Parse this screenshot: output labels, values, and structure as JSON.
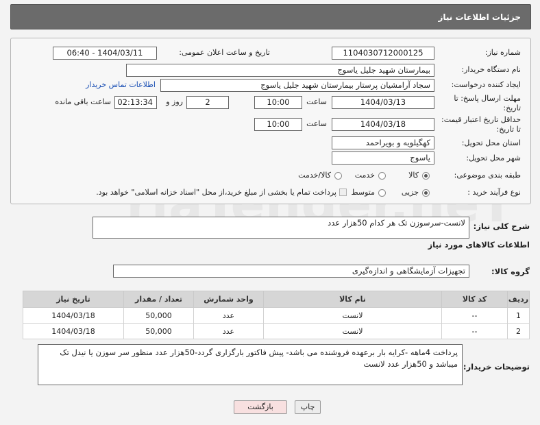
{
  "header": {
    "title": "جزئیات اطلاعات نیاز"
  },
  "form": {
    "need_number_label": "شماره نیاز:",
    "need_number": "1104030712000125",
    "announce_label": "تاریخ و ساعت اعلان عمومی:",
    "announce_value": "1404/03/11 - 06:40",
    "buyer_org_label": "نام دستگاه خریدار:",
    "buyer_org": "بیمارستان شهید جلیل یاسوج",
    "creator_label": "ایجاد کننده درخواست:",
    "creator": "سجاد آرامشیان پرستار بیمارستان شهید جلیل یاسوج",
    "contact_link": "اطلاعات تماس خریدار",
    "deadline_label_1": "مهلت ارسال پاسخ: تا",
    "deadline_label_2": "تاریخ:",
    "deadline_date": "1404/03/13",
    "time_label": "ساعت",
    "deadline_time": "10:00",
    "days_value": "2",
    "days_label": "روز و",
    "remaining_value": "02:13:34",
    "remaining_label": "ساعت باقی مانده",
    "price_label_1": "حداقل تاریخ اعتبار قیمت:",
    "price_label_2": "تا تاریخ:",
    "price_date": "1404/03/18",
    "price_time": "10:00",
    "province_label": "استان محل تحویل:",
    "province": "کهگیلویه و بویراحمد",
    "city_label": "شهر محل تحویل:",
    "city": "یاسوج",
    "category_label": "طبقه بندی موضوعی:",
    "category_options": [
      "کالا",
      "خدمت",
      "کالا/خدمت"
    ],
    "category_selected": "کالا",
    "process_label": "نوع فرآیند خرید :",
    "process_options": [
      "جزیی",
      "متوسط"
    ],
    "process_selected": "جزیی",
    "payment_note": "پرداخت تمام یا بخشی از مبلغ خرید،از محل \"اسناد خزانه اسلامی\" خواهد بود."
  },
  "description": {
    "label": "شرح کلی نیاز:",
    "value": "لانست-سرسوزن تک هر کدام 50هزار عدد"
  },
  "goods": {
    "section_title": "اطلاعات کالاهای مورد نیاز",
    "group_label": "گروه کالا:",
    "group_value": "تجهیزات آزمایشگاهی و اندازه‌گیری",
    "columns": [
      "ردیف",
      "کد کالا",
      "نام کالا",
      "واحد شمارش",
      "تعداد / مقدار",
      "تاریخ نیاز"
    ],
    "rows": [
      [
        "1",
        "--",
        "لانست",
        "عدد",
        "50,000",
        "1404/03/18"
      ],
      [
        "2",
        "--",
        "لانست",
        "عدد",
        "50,000",
        "1404/03/18"
      ]
    ]
  },
  "buyer_notes": {
    "label": "توضیحات خریدار:",
    "value": "پرداخت 4ماهه -کرایه بار برعهده فروشنده می باشد- پیش فاکتور بارگزاری گردد-50هزار عدد منظور سر سوزن یا نیدل تک میباشد و 50هزار عدد لانست"
  },
  "buttons": {
    "print": "چاپ",
    "back": "بازگشت"
  },
  "watermark": {
    "text": "AriaTender.neT"
  },
  "colors": {
    "header_bg": "#6b6b6b",
    "link": "#1a4fb4",
    "back_button_bg": "#f8e0e0",
    "print_button_bg": "#ececec"
  }
}
